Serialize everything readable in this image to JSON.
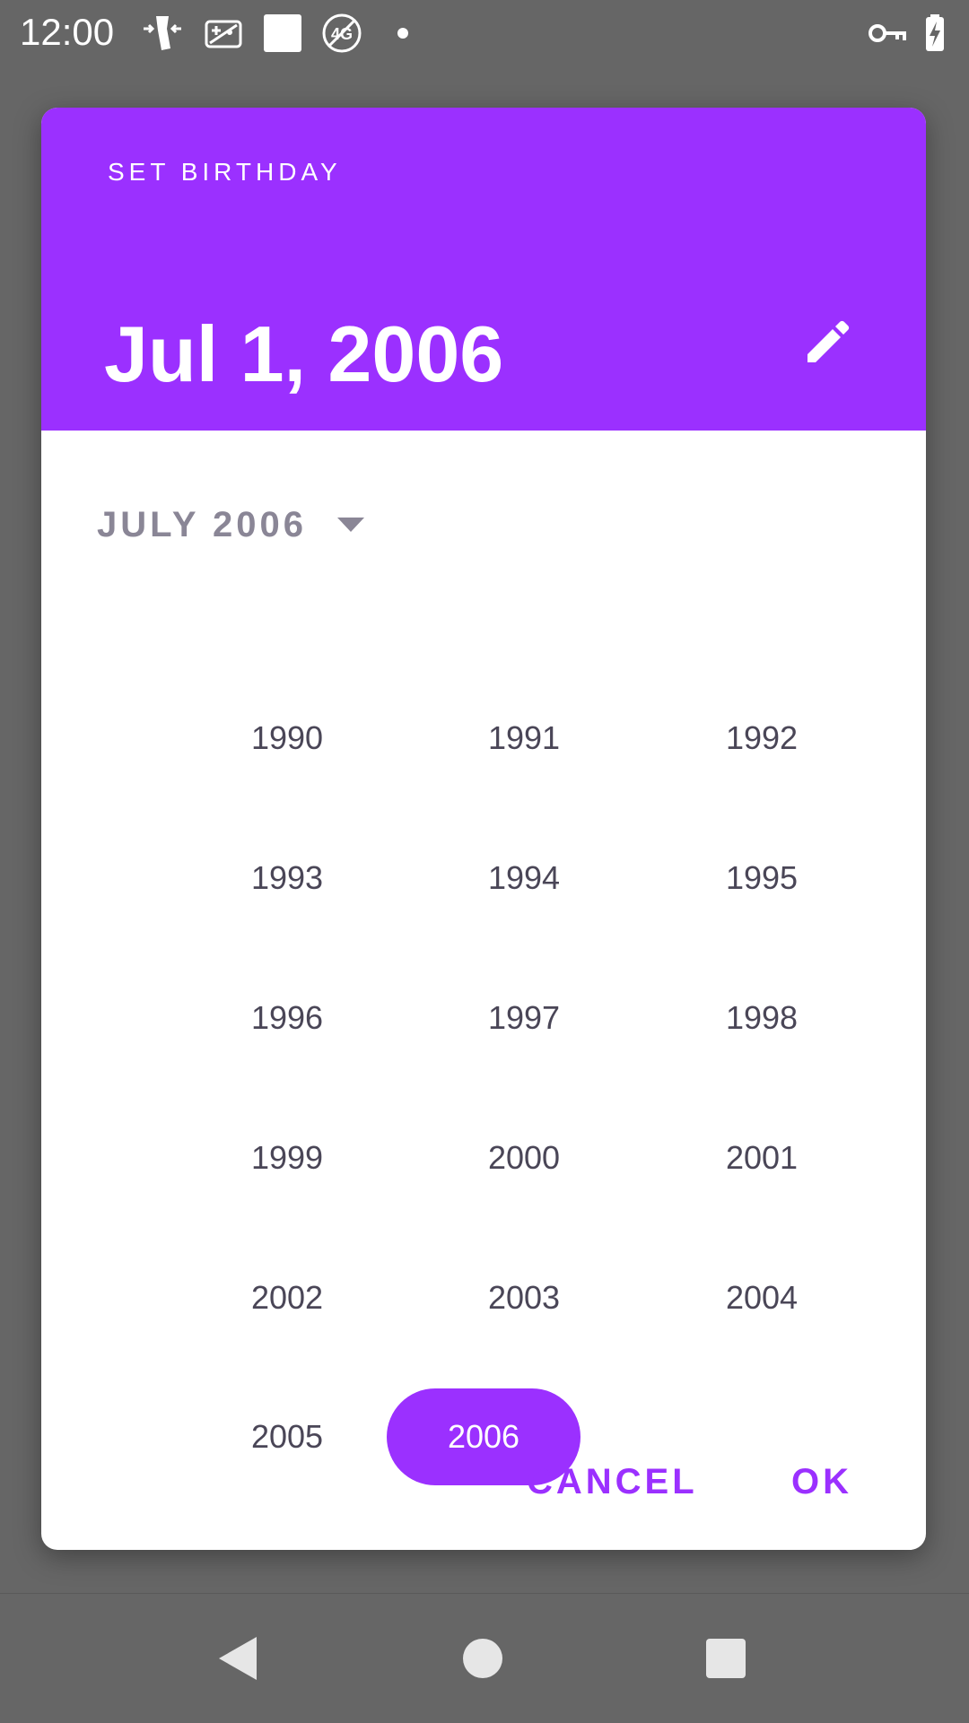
{
  "status_bar": {
    "time": "12:00",
    "icons": [
      "sensor-icon",
      "game-controller-icon",
      "square-notification-icon",
      "4g-off-icon",
      "dot-icon",
      "vpn-key-icon",
      "battery-charging-icon"
    ]
  },
  "dialog": {
    "title": "SET BIRTHDAY",
    "selected_date": "Jul 1, 2006",
    "month_year": "JULY 2006",
    "years": [
      "1990",
      "1991",
      "1992",
      "1993",
      "1994",
      "1995",
      "1996",
      "1997",
      "1998",
      "1999",
      "2000",
      "2001",
      "2002",
      "2003",
      "2004",
      "2005",
      "2006"
    ],
    "selected_year": "2006",
    "cancel_label": "CANCEL",
    "ok_label": "OK"
  },
  "colors": {
    "accent": "#9b30ff",
    "scrim": "#666666",
    "year_text": "#4a4657"
  },
  "nav_bar": {
    "icons": [
      "back-icon",
      "home-icon",
      "recents-icon"
    ]
  }
}
